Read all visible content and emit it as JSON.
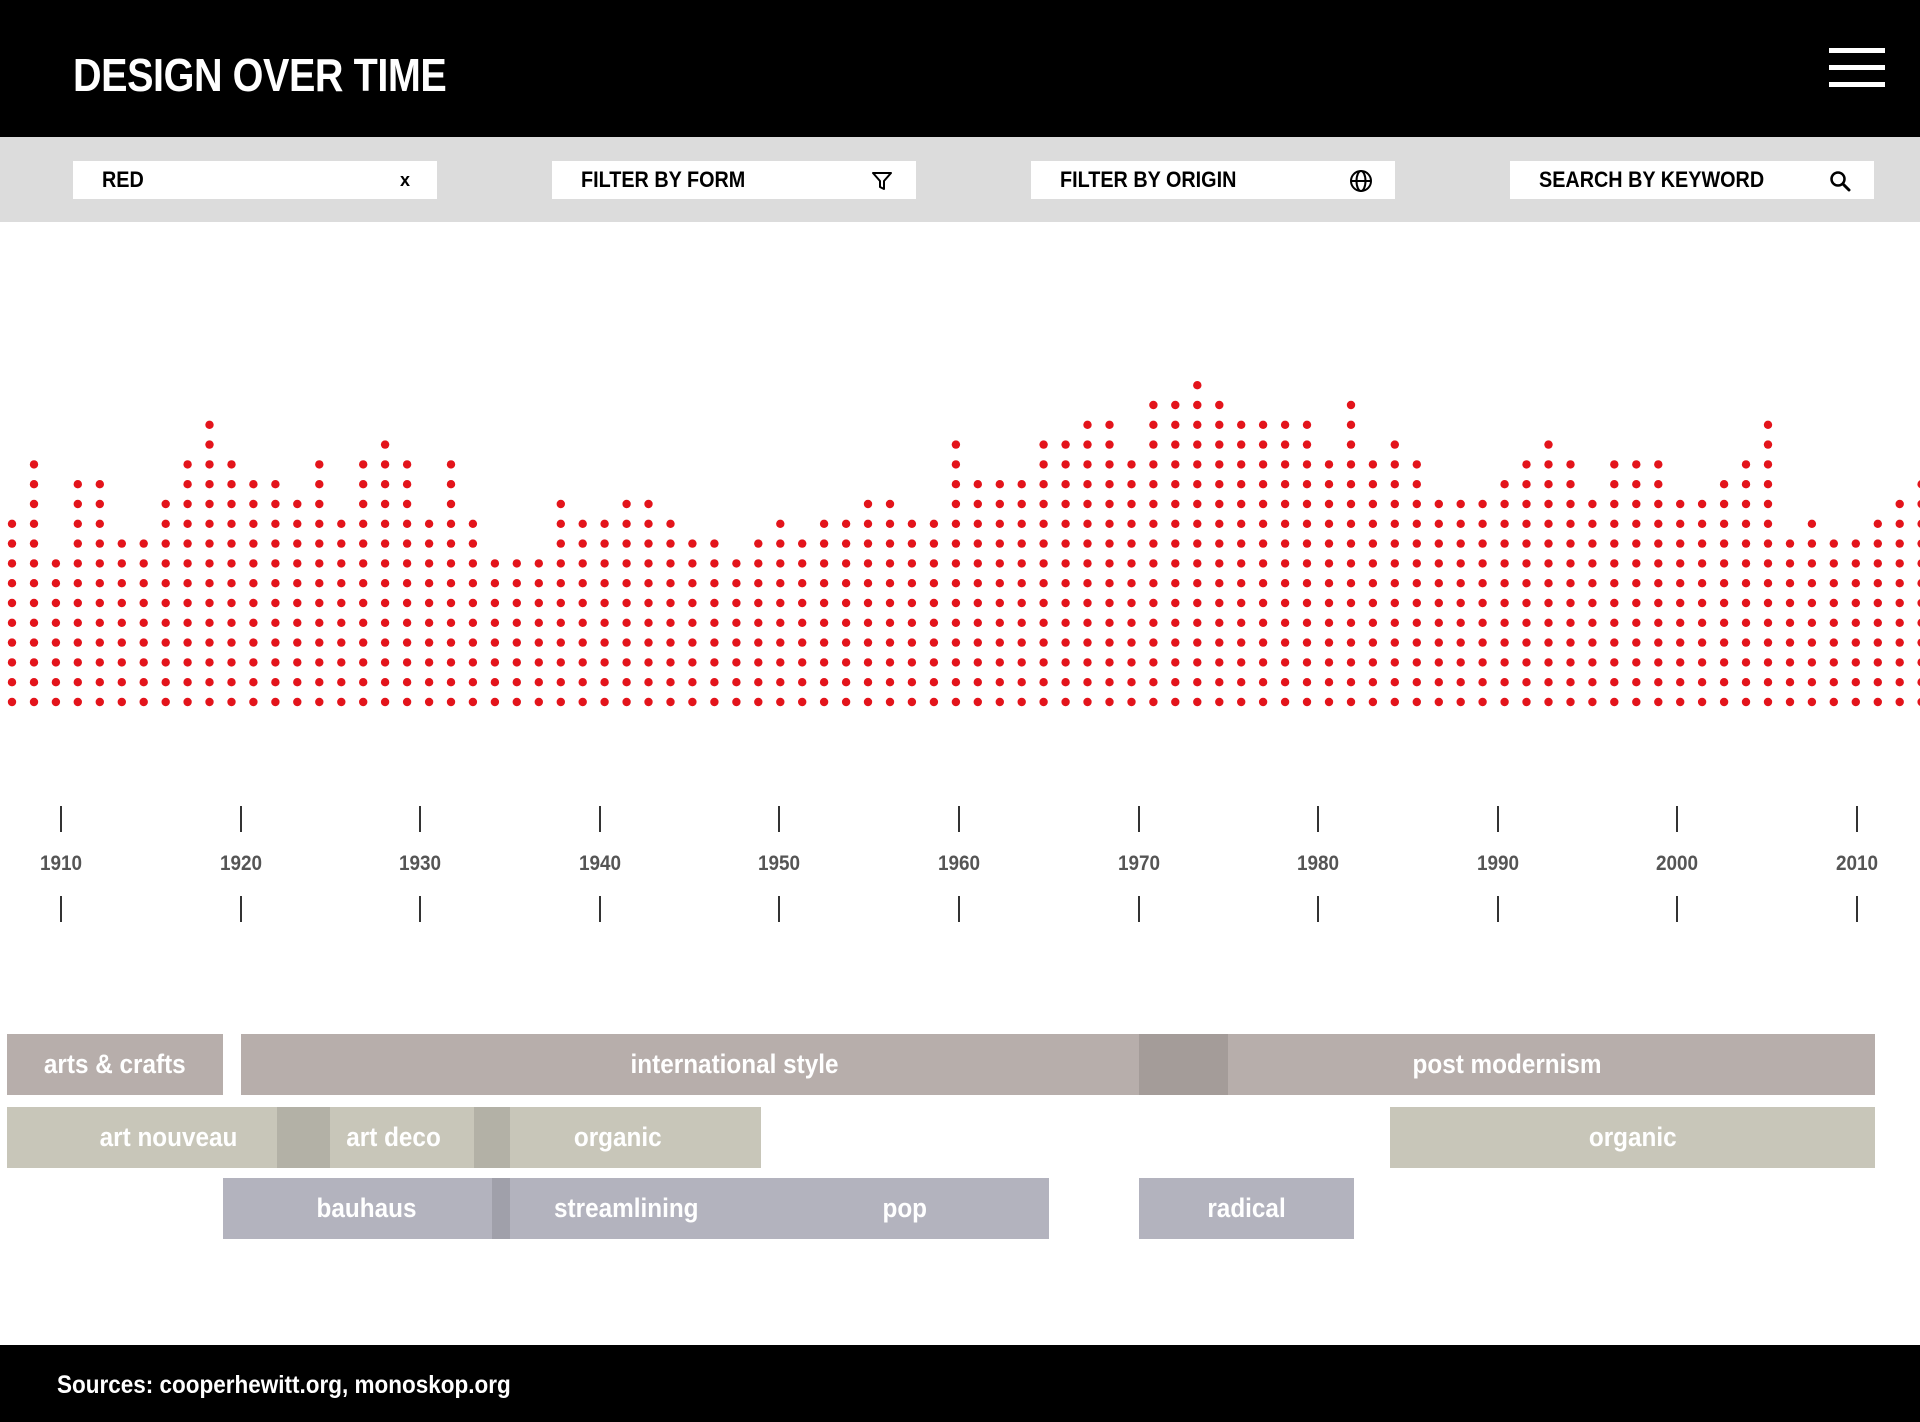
{
  "app": {
    "title": "DESIGN OVER TIME",
    "menu_icon": "hamburger-menu-icon"
  },
  "filters": {
    "color": {
      "value": "RED",
      "clear_label": "x"
    },
    "form": {
      "label": "FILTER BY FORM",
      "icon": "filter-funnel-icon"
    },
    "origin": {
      "label": "FILTER BY ORIGIN",
      "icon": "globe-icon"
    },
    "keyword": {
      "label": "SEARCH BY KEYWORD",
      "icon": "search-icon"
    }
  },
  "colors": {
    "dot": "#e3141b",
    "arts_crafts": "#b7aeab",
    "nouveau_organic": "#c8c6b9",
    "functional": "#b3b3be"
  },
  "chart_data": {
    "type": "scatter",
    "title": "",
    "xlabel": "",
    "ylabel": "",
    "x_range": [
      1907,
      2011
    ],
    "x_ticks": [
      "1910",
      "1920",
      "1930",
      "1940",
      "1950",
      "1960",
      "1970",
      "1980",
      "1990",
      "2000",
      "2010"
    ],
    "series": [
      {
        "values": [
          10,
          13,
          8,
          12,
          12,
          9,
          9,
          11,
          13,
          15,
          13,
          12,
          12,
          11,
          13,
          10,
          13,
          14,
          13,
          10,
          13,
          10,
          8,
          8,
          8,
          11,
          10,
          10,
          11,
          11,
          10,
          9,
          9,
          8,
          9,
          10,
          9,
          10,
          10,
          11,
          11,
          10,
          10,
          14,
          12,
          12,
          12,
          14,
          14,
          15,
          15,
          13,
          16,
          16,
          17,
          16,
          15,
          15,
          15,
          15,
          13,
          16,
          13,
          14,
          13,
          11,
          11,
          11,
          12,
          13,
          14,
          13,
          11,
          13,
          13,
          13,
          11,
          11,
          12,
          13,
          15,
          9,
          10,
          9,
          9,
          10,
          11,
          12,
          13,
          11
        ]
      }
    ]
  },
  "periods": [
    {
      "label": "arts & crafts",
      "style": "arts_crafts",
      "row": 0,
      "start": 1907,
      "end": 1919
    },
    {
      "label": "international style",
      "style": "arts_crafts",
      "row": 0,
      "start": 1920,
      "end": 1975
    },
    {
      "label": "post modernism",
      "style": "arts_crafts",
      "row": 0,
      "start": 1970,
      "end": 2011
    },
    {
      "label": "art nouveau",
      "style": "nouveau_organic",
      "row": 1,
      "start": 1907,
      "end": 1925
    },
    {
      "label": "art deco",
      "style": "nouveau_organic",
      "row": 1,
      "start": 1922,
      "end": 1935
    },
    {
      "label": "organic",
      "style": "nouveau_organic",
      "row": 1,
      "start": 1933,
      "end": 1949
    },
    {
      "label": "organic",
      "style": "nouveau_organic",
      "row": 1,
      "start": 1984,
      "end": 2011
    },
    {
      "label": "bauhaus",
      "style": "functional",
      "row": 2,
      "start": 1919,
      "end": 1935
    },
    {
      "label": "streamlining",
      "style": "functional",
      "row": 2,
      "start": 1934,
      "end": 1949
    },
    {
      "label": "pop",
      "style": "functional",
      "row": 2,
      "start": 1949,
      "end": 1965
    },
    {
      "label": "radical",
      "style": "functional",
      "row": 2,
      "start": 1970,
      "end": 1982
    }
  ],
  "footer": {
    "sources": "Sources: cooperhewitt.org, monoskop.org"
  }
}
